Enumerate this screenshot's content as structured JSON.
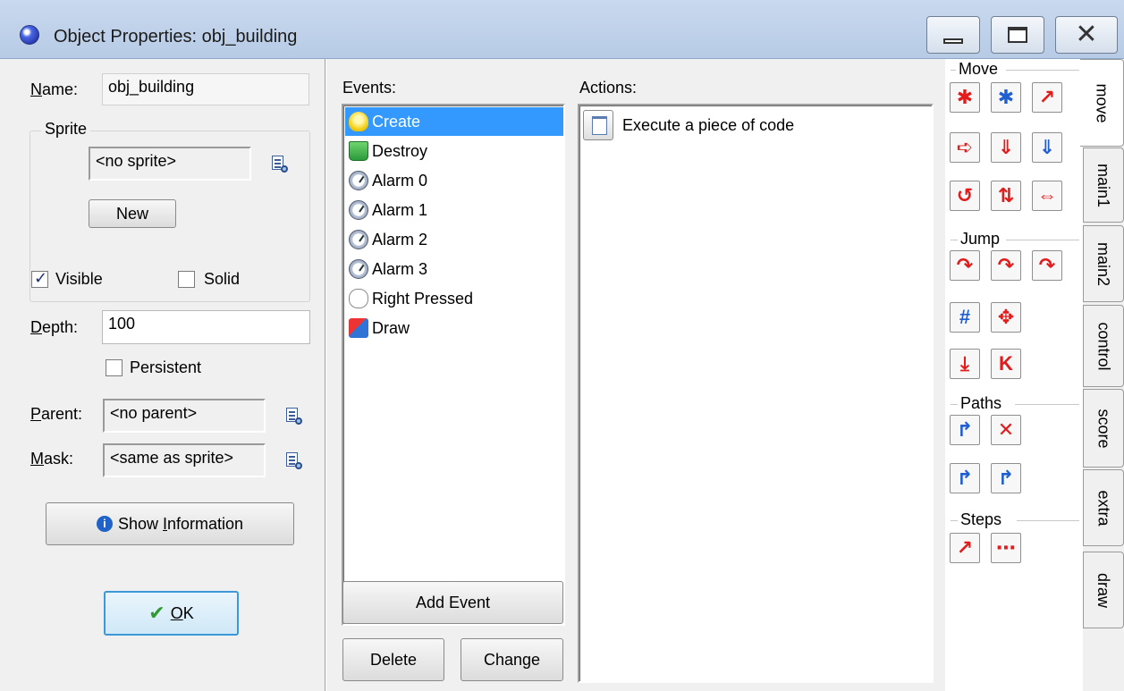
{
  "window": {
    "title": "Object Properties: obj_building"
  },
  "left": {
    "name_label": "Name:",
    "name_value": "obj_building",
    "sprite_group": "Sprite",
    "sprite_value": "<no sprite>",
    "new_button": "New",
    "visible_label": "Visible",
    "visible_checked": true,
    "solid_label": "Solid",
    "solid_checked": false,
    "depth_label": "Depth:",
    "depth_value": "100",
    "persistent_label": "Persistent",
    "persistent_checked": false,
    "parent_label": "Parent:",
    "parent_value": "<no parent>",
    "mask_label": "Mask:",
    "mask_value": "<same as sprite>",
    "show_info_button": "Show Information",
    "ok_button": "OK"
  },
  "events": {
    "label": "Events:",
    "items": [
      {
        "label": "Create",
        "icon": "bulb-icon",
        "selected": true
      },
      {
        "label": "Destroy",
        "icon": "trash-icon"
      },
      {
        "label": "Alarm 0",
        "icon": "clock-icon"
      },
      {
        "label": "Alarm 1",
        "icon": "clock-icon"
      },
      {
        "label": "Alarm 2",
        "icon": "clock-icon"
      },
      {
        "label": "Alarm 3",
        "icon": "clock-icon"
      },
      {
        "label": "Right Pressed",
        "icon": "mouse-icon"
      },
      {
        "label": "Draw",
        "icon": "draw-icon"
      }
    ],
    "add_button": "Add Event",
    "delete_button": "Delete",
    "change_button": "Change"
  },
  "actions": {
    "label": "Actions:",
    "items": [
      {
        "label": "Execute a piece of code",
        "icon": "code-page-icon"
      }
    ]
  },
  "palette": {
    "sections": [
      "Move",
      "Jump",
      "Paths",
      "Steps"
    ],
    "tabs": [
      "move",
      "main1",
      "main2",
      "control",
      "score",
      "extra",
      "draw"
    ],
    "active_tab": "move",
    "colors": {
      "red": "#e31b1b",
      "blue": "#1f5fd1"
    }
  }
}
